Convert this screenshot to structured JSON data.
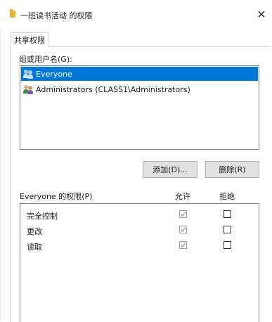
{
  "window": {
    "title": "一班读书活动 的权限",
    "close_glyph": "✕"
  },
  "tabs": [
    {
      "label": "共享权限"
    }
  ],
  "group_section": {
    "label": "组或用户名(G):",
    "users": [
      {
        "name": "Everyone",
        "selected": true,
        "icon": "users-icon"
      },
      {
        "name": "Administrators (CLASS1\\Administrators)",
        "selected": false,
        "icon": "admin-users-icon"
      }
    ]
  },
  "buttons": {
    "add": "添加(D)...",
    "remove": "删除(R)"
  },
  "permissions": {
    "header": "Everyone 的权限(P)",
    "allow_header": "允许",
    "deny_header": "拒绝",
    "rows": [
      {
        "name": "完全控制",
        "allow": true,
        "deny": false
      },
      {
        "name": "更改",
        "allow": true,
        "deny": false
      },
      {
        "name": "读取",
        "allow": true,
        "deny": false
      }
    ]
  },
  "colors": {
    "selection": "#0078d7",
    "folder": "#e7b43b"
  }
}
